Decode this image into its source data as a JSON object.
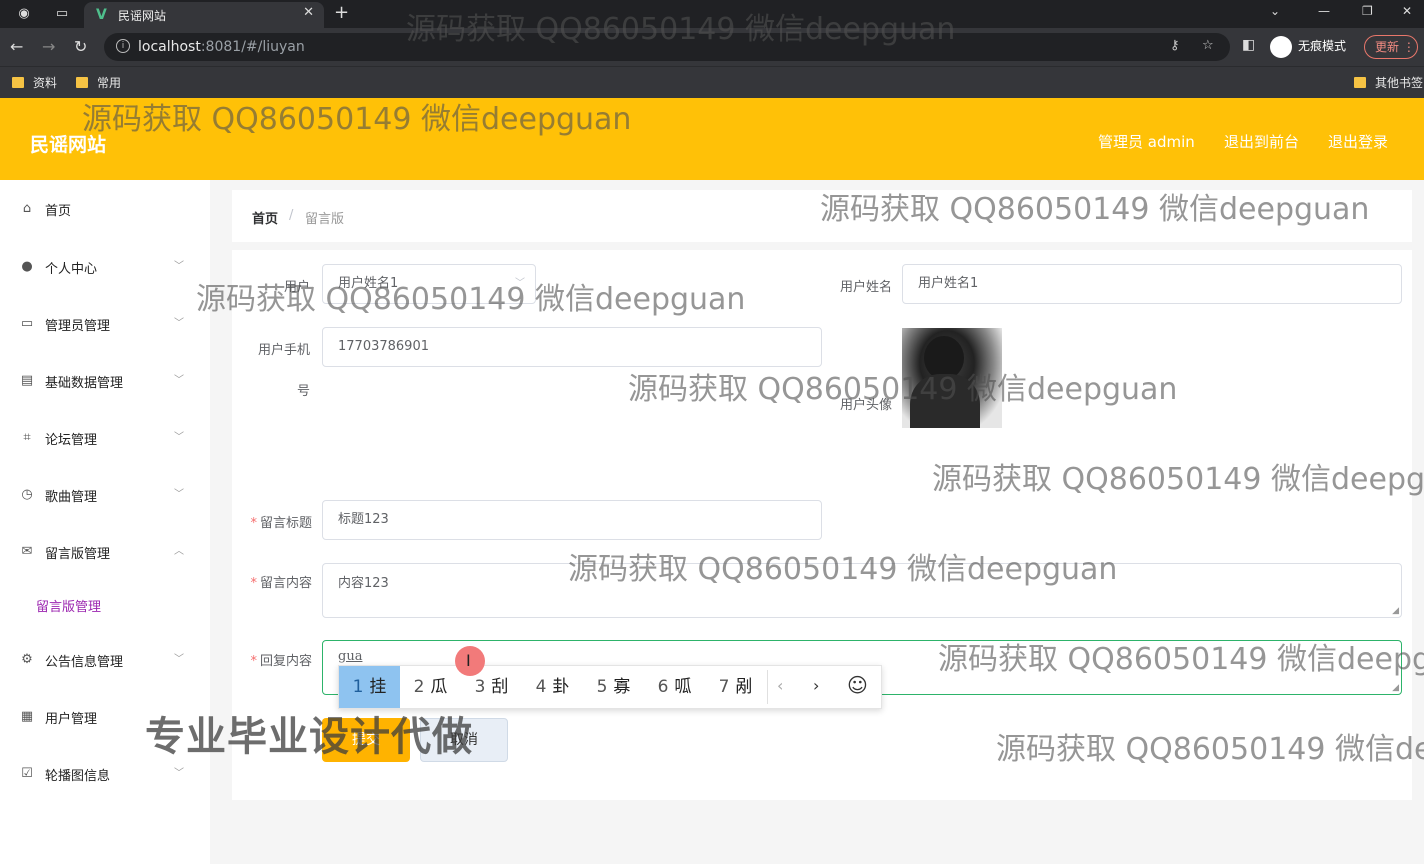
{
  "browser": {
    "tab_title": "民谣网站",
    "tab_logo": "V",
    "url_host": "localhost",
    "url_rest": ":8081/#/liuyan",
    "incognito_label": "无痕模式",
    "update_label": "更新",
    "bookmarks": [
      "资料",
      "常用"
    ],
    "other_bookmarks": "其他书签"
  },
  "header": {
    "brand": "民谣网站",
    "admin": "管理员 admin",
    "to_front": "退出到前台",
    "logout": "退出登录"
  },
  "sidebar": {
    "items": [
      {
        "label": "首页",
        "icon": "home-icon"
      },
      {
        "label": "个人中心",
        "icon": "user-icon"
      },
      {
        "label": "管理员管理",
        "icon": "chat-icon"
      },
      {
        "label": "基础数据管理",
        "icon": "card-icon"
      },
      {
        "label": "论坛管理",
        "icon": "crop-icon"
      },
      {
        "label": "歌曲管理",
        "icon": "clock-icon"
      },
      {
        "label": "留言版管理",
        "icon": "mail-icon"
      },
      {
        "label": "公告信息管理",
        "icon": "settings-icon"
      },
      {
        "label": "用户管理",
        "icon": "doc-icon"
      },
      {
        "label": "轮播图信息",
        "icon": "check-icon"
      }
    ],
    "sub_item": "留言版管理"
  },
  "breadcrumb": {
    "home": "首页",
    "separator": "/",
    "current": "留言版"
  },
  "form": {
    "user_select_label": "用户",
    "user_select_value": "用户姓名1",
    "user_name_label": "用户姓名",
    "user_name_value": "用户姓名1",
    "phone_label_1": "用户手机",
    "phone_label_2": "号",
    "phone_value": "17703786901",
    "avatar_label": "用户头像",
    "title_label": "留言标题",
    "title_value": "标题123",
    "content_label": "留言内容",
    "content_value": "内容123",
    "reply_label": "回复内容",
    "reply_value": "gua",
    "submit_label": "提交",
    "cancel_label": "取消"
  },
  "ime": {
    "candidates": [
      {
        "num": "1",
        "char": "挂"
      },
      {
        "num": "2",
        "char": "瓜"
      },
      {
        "num": "3",
        "char": "刮"
      },
      {
        "num": "4",
        "char": "卦"
      },
      {
        "num": "5",
        "char": "寡"
      },
      {
        "num": "6",
        "char": "呱"
      },
      {
        "num": "7",
        "char": "剐"
      }
    ],
    "prev": "‹",
    "next": "›",
    "emoji": "☺"
  },
  "watermarks": {
    "text": "源码获取 QQ86050149 微信deepguan",
    "big_text": "专业毕业设计代做"
  }
}
